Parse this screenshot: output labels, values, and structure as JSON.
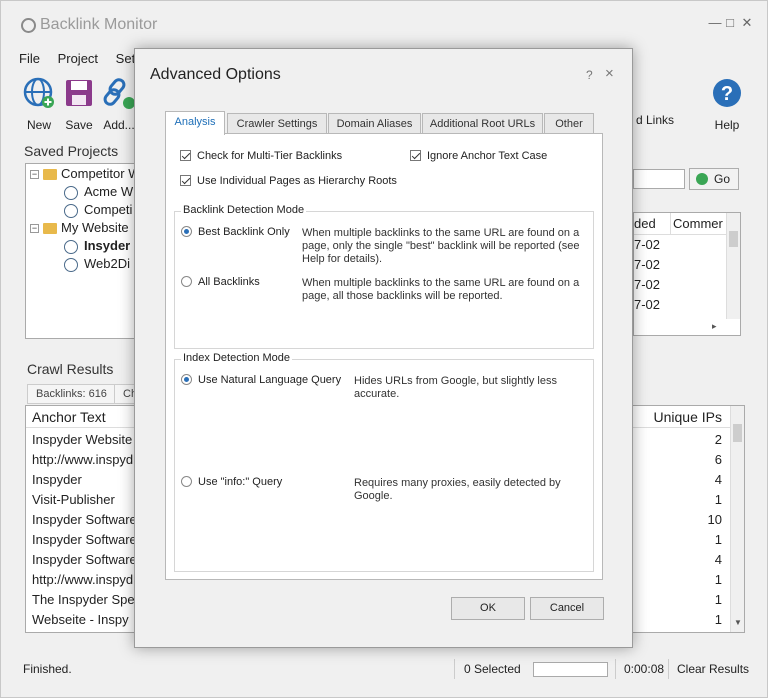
{
  "app": {
    "title": "Backlink Monitor"
  },
  "menu": [
    "File",
    "Project",
    "Setti"
  ],
  "toolbar": {
    "new": "New",
    "save": "Save",
    "add": "Add...",
    "links": "d Links",
    "help": "Help"
  },
  "saved_projects": {
    "title": "Saved Projects",
    "tree": [
      {
        "label": "Competitor W",
        "level": 0,
        "type": "folder"
      },
      {
        "label": "Acme W",
        "level": 1,
        "type": "site"
      },
      {
        "label": "Competi",
        "level": 1,
        "type": "site"
      },
      {
        "label": "My Website",
        "level": 0,
        "type": "folder"
      },
      {
        "label": "Insyder",
        "level": 1,
        "type": "site",
        "bold": true
      },
      {
        "label": "Web2Di",
        "level": 1,
        "type": "site"
      }
    ]
  },
  "search": {
    "go_label": "Go"
  },
  "links_table": {
    "headers": [
      "ded",
      "Commer"
    ],
    "rows": [
      "7-02",
      "7-02",
      "7-02",
      "7-02"
    ]
  },
  "crawl_results": {
    "title": "Crawl Results",
    "tabs": [
      "Backlinks: 616",
      "Ch"
    ],
    "headers": {
      "anchor": "Anchor Text",
      "ips": "Unique IPs"
    },
    "rows": [
      {
        "anchor": "Inspyder Website",
        "ips": "2"
      },
      {
        "anchor": "http://www.inspyd",
        "ips": "6"
      },
      {
        "anchor": "Inspyder",
        "ips": "4"
      },
      {
        "anchor": "Visit-Publisher",
        "ips": "1"
      },
      {
        "anchor": "Inspyder Software",
        "ips": "10"
      },
      {
        "anchor": "Inspyder Software",
        "ips": "1"
      },
      {
        "anchor": "Inspyder Software",
        "ips": "4"
      },
      {
        "anchor": "http://www.inspyd",
        "ips": "1"
      },
      {
        "anchor": "The Inspyder Spe",
        "ips": "1"
      },
      {
        "anchor": "Webseite - Inspy",
        "ips": "1"
      }
    ]
  },
  "status": {
    "text": "Finished.",
    "selected": "0 Selected",
    "elapsed": "0:00:08",
    "clear": "Clear Results"
  },
  "dialog": {
    "title": "Advanced Options",
    "help_glyph": "?",
    "close_glyph": "×",
    "tabs": [
      "Analysis",
      "Crawler Settings",
      "Domain Aliases",
      "Additional Root URLs",
      "Other"
    ],
    "options": {
      "multi_tier": "Check for Multi-Tier Backlinks",
      "ignore_case": "Ignore Anchor Text Case",
      "individual_pages": "Use Individual Pages as Hierarchy Roots"
    },
    "backlink_mode": {
      "label": "Backlink Detection Mode",
      "best": "Best Backlink Only",
      "best_desc": "When multiple backlinks to the same URL are found on a page, only the single \"best\" backlink will be reported (see Help for details).",
      "all": "All Backlinks",
      "all_desc": "When multiple backlinks to the same URL are found on a page, all those backlinks will be reported."
    },
    "index_mode": {
      "label": "Index Detection Mode",
      "natural": "Use Natural Language Query",
      "natural_desc": "Hides URLs from Google, but slightly less accurate.",
      "info": "Use \"info:\" Query",
      "info_desc": "Requires many proxies, easily detected by Google."
    },
    "ok": "OK",
    "cancel": "Cancel"
  }
}
